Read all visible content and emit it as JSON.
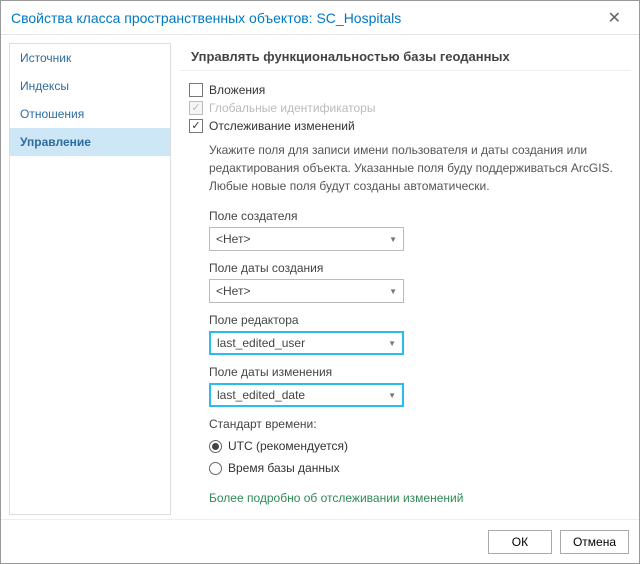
{
  "title": "Свойства класса пространственных объектов: SC_Hospitals",
  "sidebar": {
    "items": [
      {
        "label": "Источник"
      },
      {
        "label": "Индексы"
      },
      {
        "label": "Отношения"
      },
      {
        "label": "Управление"
      }
    ]
  },
  "panel": {
    "title": "Управлять функциональностью базы геоданных",
    "attachments_label": "Вложения",
    "globalid_label": "Глобальные идентификаторы",
    "tracking_label": "Отслеживание изменений",
    "description": "Укажите поля для записи имени пользователя и даты создания или редактирования объекта. Указанные поля буду поддерживаться ArcGIS. Любые новые поля будут созданы автоматически.",
    "creator_field_label": "Поле создателя",
    "creator_field_value": "<Нет>",
    "created_date_label": "Поле даты создания",
    "created_date_value": "<Нет>",
    "editor_field_label": "Поле редактора",
    "editor_field_value": "last_edited_user",
    "edited_date_label": "Поле даты изменения",
    "edited_date_value": "last_edited_date",
    "time_standard_label": "Стандарт времени:",
    "utc_label": "UTC (рекомендуется)",
    "db_time_label": "Время базы данных",
    "more_info": "Более подробно об отслеживании изменений"
  },
  "buttons": {
    "ok": "ОК",
    "cancel": "Отмена"
  }
}
